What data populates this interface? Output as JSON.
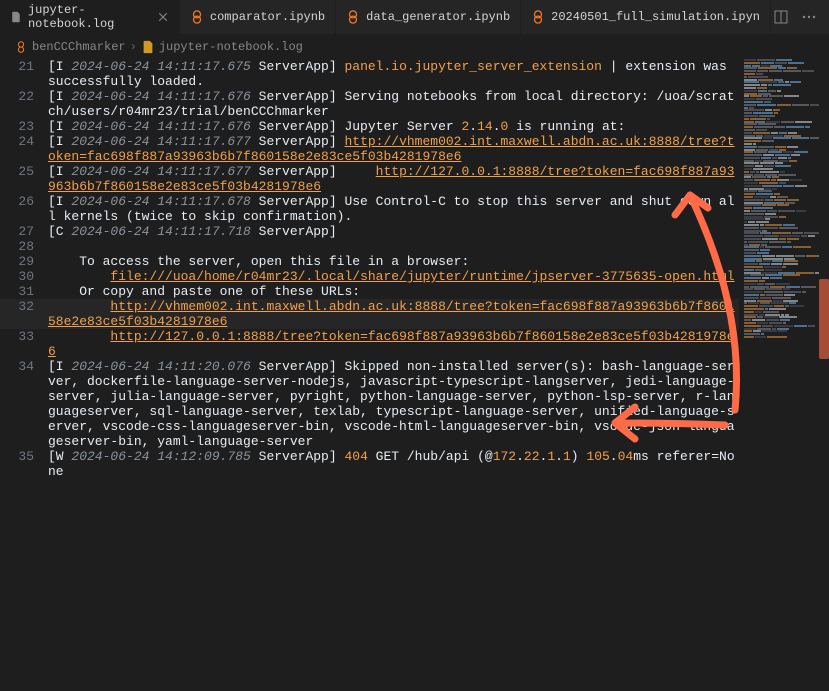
{
  "tabs": [
    {
      "label": "jupyter-notebook.log",
      "active": true
    },
    {
      "label": "comparator.ipynb",
      "active": false
    },
    {
      "label": "data_generator.ipynb",
      "active": false
    },
    {
      "label": "20240501_full_simulation.ipyn",
      "active": false
    }
  ],
  "breadcrumb": {
    "items": [
      "benCCChmarker",
      "jupyter-notebook.log"
    ]
  },
  "lines": [
    {
      "num": "21",
      "parts": [
        {
          "text": "[I ",
          "class": "c-white"
        },
        {
          "text": "2024-06-24 14:11:17.675",
          "class": "c-muted"
        },
        {
          "text": " ServerApp] ",
          "class": "c-white"
        },
        {
          "text": "panel.io.jupyter_server_extension",
          "class": "c-orange"
        },
        {
          "text": " | extension was successfully loaded.",
          "class": "c-white"
        }
      ]
    },
    {
      "num": "22",
      "parts": [
        {
          "text": "[I ",
          "class": "c-white"
        },
        {
          "text": "2024-06-24 14:11:17.676",
          "class": "c-muted"
        },
        {
          "text": " ServerApp] Serving notebooks from local directory: /uoa/scratch/users/r04mr23/trial/benCCChmarker",
          "class": "c-white"
        }
      ]
    },
    {
      "num": "23",
      "parts": [
        {
          "text": "[I ",
          "class": "c-white"
        },
        {
          "text": "2024-06-24 14:11:17.676",
          "class": "c-muted"
        },
        {
          "text": " ServerApp] Jupyter Server ",
          "class": "c-white"
        },
        {
          "text": "2",
          "class": "c-orange"
        },
        {
          "text": ".",
          "class": "c-white"
        },
        {
          "text": "14",
          "class": "c-orange"
        },
        {
          "text": ".",
          "class": "c-white"
        },
        {
          "text": "0",
          "class": "c-orange"
        },
        {
          "text": " is running at:",
          "class": "c-white"
        }
      ]
    },
    {
      "num": "24",
      "parts": [
        {
          "text": "[I ",
          "class": "c-white"
        },
        {
          "text": "2024-06-24 14:11:17.677",
          "class": "c-muted"
        },
        {
          "text": " ServerApp] ",
          "class": "c-white"
        },
        {
          "text": "http://vhmem002.int.maxwell.abdn.ac.uk:8888/tree?token=fac698f887a93963b6b7f860158e2e83ce5f03b4281978e6",
          "class": "link"
        }
      ]
    },
    {
      "num": "25",
      "parts": [
        {
          "text": "[I ",
          "class": "c-white"
        },
        {
          "text": "2024-06-24 14:11:17.677",
          "class": "c-muted"
        },
        {
          "text": " ServerApp]     ",
          "class": "c-white"
        },
        {
          "text": "http://127.0.0.1:8888/tree?token=fac698f887a93963b6b7f860158e2e83ce5f03b4281978e6",
          "class": "link"
        }
      ]
    },
    {
      "num": "26",
      "parts": [
        {
          "text": "[I ",
          "class": "c-white"
        },
        {
          "text": "2024-06-24 14:11:17.678",
          "class": "c-muted"
        },
        {
          "text": " ServerApp] Use Control-C to stop this server and shut down all kernels (twice to skip confirmation).",
          "class": "c-white"
        }
      ]
    },
    {
      "num": "27",
      "parts": [
        {
          "text": "[C ",
          "class": "c-white"
        },
        {
          "text": "2024-06-24 14:11:17.718",
          "class": "c-muted"
        },
        {
          "text": " ServerApp]",
          "class": "c-white"
        }
      ]
    },
    {
      "num": "28",
      "parts": [
        {
          "text": "    ",
          "class": "c-white"
        }
      ]
    },
    {
      "num": "29",
      "parts": [
        {
          "text": "    To access the server, open this file in a browser:",
          "class": "c-white"
        }
      ]
    },
    {
      "num": "30",
      "parts": [
        {
          "text": "        ",
          "class": "c-white"
        },
        {
          "text": "file:///uoa/home/r04mr23/.local/share/jupyter/runtime/jpserver-3775635-open.html",
          "class": "link"
        }
      ]
    },
    {
      "num": "31",
      "parts": [
        {
          "text": "    Or copy and paste one of these URLs:",
          "class": "c-white"
        }
      ]
    },
    {
      "num": "32",
      "highlighted": true,
      "parts": [
        {
          "text": "        ",
          "class": "c-white"
        },
        {
          "text": "http://vhmem002.int.maxwell.abdn.ac.uk:8888/tree?token=fac698f887a93963b6b7f860158e2e83ce5f03b4281978e6",
          "class": "link"
        }
      ]
    },
    {
      "num": "33",
      "parts": [
        {
          "text": "        ",
          "class": "c-white"
        },
        {
          "text": "http://127.0.0.1:8888/tree?token=fac698f887a93963b6b7f860158e2e83ce5f03b4281978e6",
          "class": "link"
        }
      ]
    },
    {
      "num": "34",
      "parts": [
        {
          "text": "[I ",
          "class": "c-white"
        },
        {
          "text": "2024-06-24 14:11:20.076",
          "class": "c-muted"
        },
        {
          "text": " ServerApp] Skipped non-installed server(s): bash-language-server, dockerfile-language-server-nodejs, javascript-typescript-langserver, jedi-language-server, julia-language-server, pyright, python-language-server, python-lsp-server, r-languageserver, sql-language-server, texlab, typescript-language-server, unified-language-server, vscode-css-languageserver-bin, vscode-html-languageserver-bin, vscode-json-languageserver-bin, yaml-language-server",
          "class": "c-white"
        }
      ]
    },
    {
      "num": "35",
      "parts": [
        {
          "text": "[W ",
          "class": "c-white"
        },
        {
          "text": "2024-06-24 14:12:09.785",
          "class": "c-muted"
        },
        {
          "text": " ServerApp] ",
          "class": "c-white"
        },
        {
          "text": "404",
          "class": "c-orange"
        },
        {
          "text": " GET /hub/api (@",
          "class": "c-white"
        },
        {
          "text": "172",
          "class": "c-orange"
        },
        {
          "text": ".",
          "class": "c-white"
        },
        {
          "text": "22",
          "class": "c-orange"
        },
        {
          "text": ".",
          "class": "c-white"
        },
        {
          "text": "1",
          "class": "c-orange"
        },
        {
          "text": ".",
          "class": "c-white"
        },
        {
          "text": "1",
          "class": "c-orange"
        },
        {
          "text": ") ",
          "class": "c-white"
        },
        {
          "text": "105",
          "class": "c-orange"
        },
        {
          "text": ".",
          "class": "c-white"
        },
        {
          "text": "04",
          "class": "c-orange"
        },
        {
          "text": "ms referer=None",
          "class": "c-white"
        }
      ]
    }
  ]
}
